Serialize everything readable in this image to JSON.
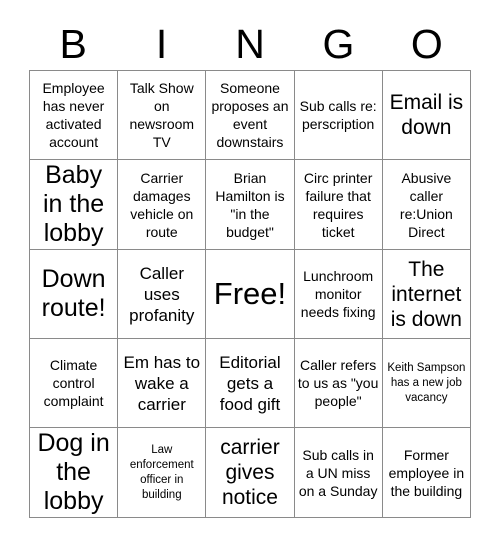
{
  "card": {
    "title": "BINGO",
    "header_letters": [
      "B",
      "I",
      "N",
      "G",
      "O"
    ],
    "rows": [
      [
        {
          "text": "Employee has never activated account",
          "size": "sm"
        },
        {
          "text": "Talk Show on newsroom TV",
          "size": "sm"
        },
        {
          "text": "Someone proposes an event downstairs",
          "size": "sm"
        },
        {
          "text": "Sub calls re: perscription",
          "size": "sm"
        },
        {
          "text": "Email is down",
          "size": "lg"
        }
      ],
      [
        {
          "text": "Baby in the lobby",
          "size": "xl"
        },
        {
          "text": "Carrier damages vehicle on route",
          "size": "sm"
        },
        {
          "text": "Brian Hamilton is \"in the budget\"",
          "size": "sm"
        },
        {
          "text": "Circ printer failure that requires ticket",
          "size": "sm"
        },
        {
          "text": "Abusive caller re:Union Direct",
          "size": "sm"
        }
      ],
      [
        {
          "text": "Down route!",
          "size": "xl"
        },
        {
          "text": "Caller uses profanity",
          "size": "md"
        },
        {
          "text": "Free!",
          "size": "free"
        },
        {
          "text": "Lunchroom monitor needs fixing",
          "size": "sm"
        },
        {
          "text": "The internet is down",
          "size": "lg"
        }
      ],
      [
        {
          "text": "Climate control complaint",
          "size": "sm"
        },
        {
          "text": "Em has to wake a carrier",
          "size": "md"
        },
        {
          "text": "Editorial gets a food gift",
          "size": "md"
        },
        {
          "text": "Caller refers to us as \"you people\"",
          "size": "sm"
        },
        {
          "text": "Keith Sampson has a new job vacancy",
          "size": "xs"
        }
      ],
      [
        {
          "text": "Dog in the lobby",
          "size": "xl"
        },
        {
          "text": "Law enforcement officer in building",
          "size": "xs"
        },
        {
          "text": "carrier gives notice",
          "size": "lg"
        },
        {
          "text": "Sub calls in a UN miss on a Sunday",
          "size": "sm"
        },
        {
          "text": "Former employee in the building",
          "size": "sm"
        }
      ]
    ]
  }
}
